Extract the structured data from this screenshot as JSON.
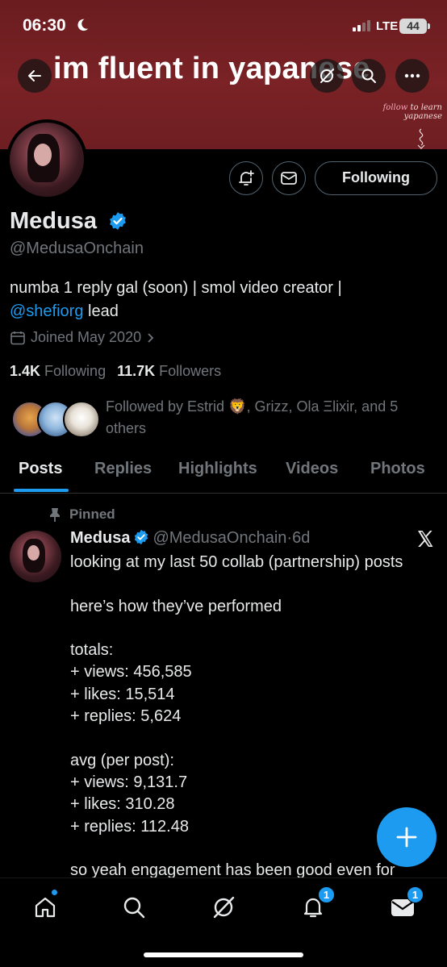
{
  "status_bar": {
    "time": "06:30",
    "network": "LTE",
    "battery": "44"
  },
  "banner": {
    "title": "im fluent in yapanese",
    "note_accent": "follow",
    "note_rest": " to learn yapanese",
    "color": "#7a2226"
  },
  "profile": {
    "name": "Medusa",
    "handle": "@MedusaOnchain",
    "following_button": "Following",
    "bio_line1": "numba 1 reply gal (soon) | smol video creator |",
    "bio_mention": "@shefiorg",
    "bio_line2_rest": " lead",
    "joined": "Joined May 2020",
    "following_count": "1.4K",
    "following_label": "Following",
    "followers_count": "11.7K",
    "followers_label": "Followers",
    "followed_by": "Followed by Estrid 🦁, Grizz, Ola Ξlixir, and 5 others"
  },
  "tabs": [
    "Posts",
    "Replies",
    "Highlights",
    "Videos",
    "Photos"
  ],
  "pinned_post": {
    "pinned_label": "Pinned",
    "author": "Medusa",
    "handle": "@MedusaOnchain",
    "separator": "·",
    "age": "6d",
    "text": "looking at my last 50 collab (partnership) posts\n\nhere’s how they’ve performed\n\ntotals:\n+ views: 456,585\n+ likes: 15,514\n+ replies: 5,624\n\navg (per post):\n+ views: 9,131.7\n+ likes: 310.28\n+ replies: 112.48\n\nso yeah engagement has been good even for"
  },
  "bottom_nav": {
    "items": [
      "home-icon",
      "search-icon",
      "grok-icon",
      "bell-icon",
      "mail-icon"
    ],
    "notifications_badge": "1",
    "messages_badge": "1"
  },
  "colors": {
    "accent": "#1d9bf0",
    "background": "#000000",
    "secondary_text": "#71767b"
  }
}
